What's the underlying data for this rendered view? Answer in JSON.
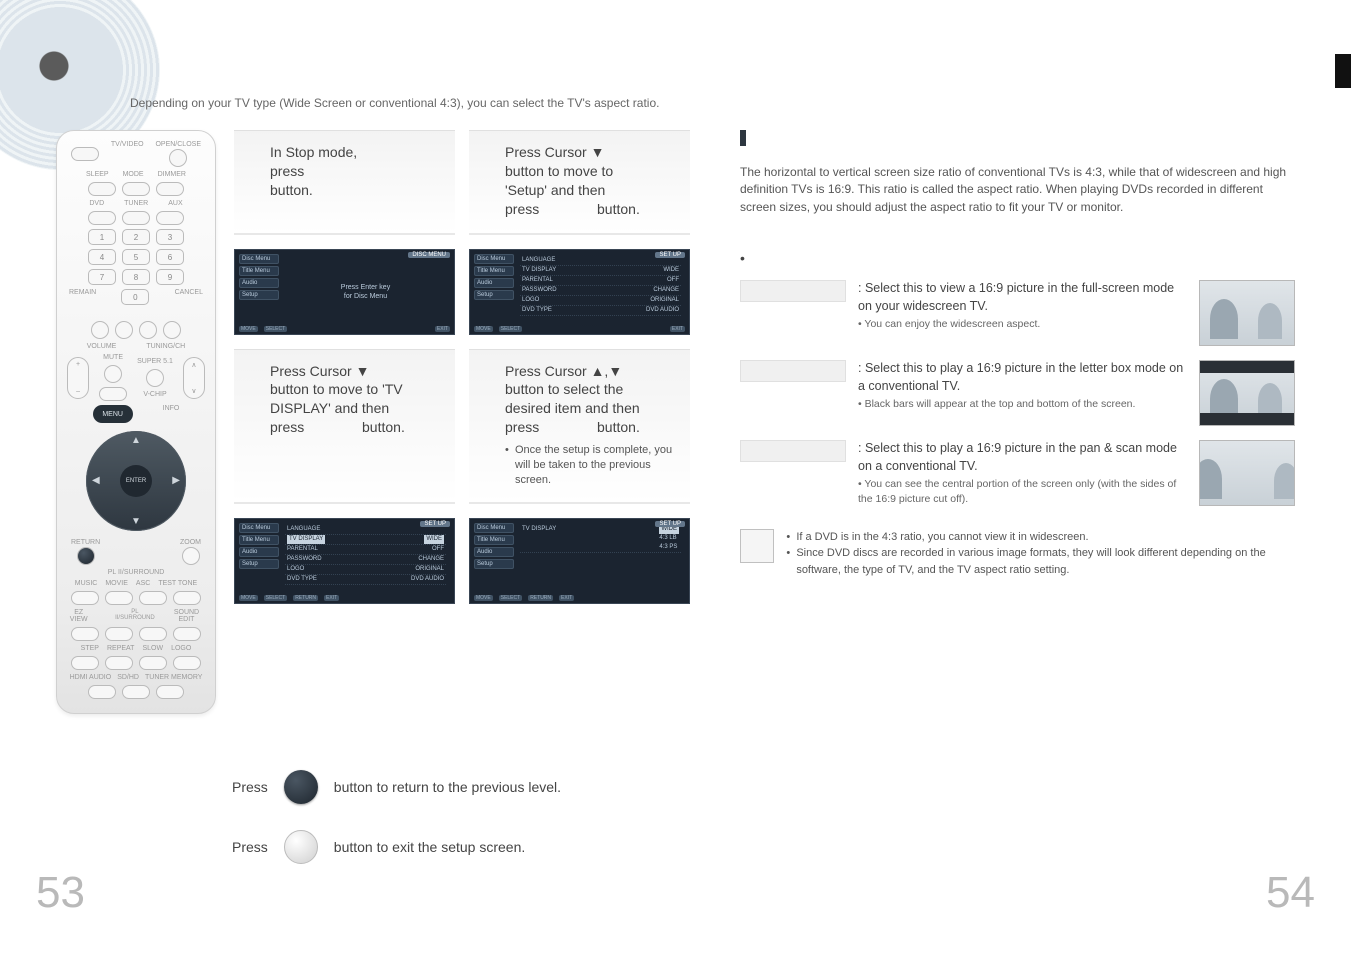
{
  "lead": "Depending on your TV type (Wide Screen  or conventional 4:3), you can select the TV's aspect ratio.",
  "remote": {
    "labels": {
      "openclose": "OPEN/CLOSE",
      "tvvideo": "TV/VIDEO",
      "sleep": "SLEEP",
      "mode": "MODE",
      "dimmer": "DIMMER",
      "dvd": "DVD",
      "tuner": "TUNER",
      "aux": "AUX",
      "remain": "REMAIN",
      "cancel": "CANCEL",
      "volume": "VOLUME",
      "tuning": "TUNING/CH",
      "mute": "MUTE",
      "super": "SUPER 5.1",
      "vchip": "V-CHIP",
      "menu": "MENU",
      "info": "INFO",
      "enter": "ENTER",
      "return": "RETURN",
      "zoom": "ZOOM",
      "plii": "PL II/SURROUND",
      "music": "MUSIC",
      "movie": "MOVIE",
      "asc": "ASC",
      "testtone": "TEST TONE",
      "ezview": "EZ VIEW",
      "soundedit": "SOUND EDIT",
      "step": "STEP",
      "repeat": "REPEAT",
      "slow": "SLOW",
      "logo": "LOGO",
      "hdmiaudio": "HDMI AUDIO",
      "sdhd": "SD/HD",
      "tunermemory": "TUNER MEMORY"
    }
  },
  "steps": {
    "s1": {
      "line1": "In Stop mode,",
      "line2": "press",
      "line3": "button."
    },
    "s2": {
      "line1": "Press Cursor ▼",
      "line2": "button to move to",
      "line3": "'Setup' and then",
      "line4": "press",
      "line5": "button."
    },
    "s3": {
      "line1": "Press Cursor ▼",
      "line2": "button to move to 'TV",
      "line3": "DISPLAY' and then",
      "line4": "press",
      "line5": "button."
    },
    "s4": {
      "line1": "Press Cursor ▲,▼",
      "line2": "button to select the",
      "line3": "desired item and then",
      "line4": "press",
      "line5": "button.",
      "note": "Once the setup is complete, you will be taken to the previous screen."
    }
  },
  "osd": {
    "tabs": [
      "Disc Menu",
      "Title Menu",
      "Audio",
      "Setup"
    ],
    "setup": "SET UP",
    "discmenu": "DISC MENU",
    "centerA": "Press Enter key",
    "centerB": "for Disc Menu",
    "items": [
      {
        "k": "LANGUAGE",
        "v": ""
      },
      {
        "k": "TV DISPLAY",
        "v": "WIDE"
      },
      {
        "k": "PARENTAL",
        "v": "OFF"
      },
      {
        "k": "PASSWORD",
        "v": "CHANGE"
      },
      {
        "k": "LOGO",
        "v": "ORIGINAL"
      },
      {
        "k": "DVD TYPE",
        "v": "DVD AUDIO"
      }
    ],
    "tvopts": [
      "WIDE",
      "4:3 LB",
      "4:3 PS"
    ],
    "foot": [
      "MOVE",
      "SELECT",
      "RETURN",
      "EXIT"
    ]
  },
  "right": {
    "desc": "The horizontal to vertical screen size ratio of conventional TVs is 4:3, while that of widescreen and high definition TVs is 16:9. This ratio is called the aspect ratio. When playing DVDs recorded in different screen sizes, you should adjust the aspect ratio to fit your TV or monitor.",
    "opts": [
      {
        "main": ": Select this to view a 16:9 picture in the full-screen mode on your widescreen TV.",
        "sub": "• You can enjoy the widescreen aspect."
      },
      {
        "main": ": Select this to play a 16:9 picture in the letter box mode on a conventional TV.",
        "sub": "• Black bars will appear at the top and bottom of the screen."
      },
      {
        "main": ": Select this to play a 16:9 picture in the pan & scan mode on a conventional TV.",
        "sub": "• You can see the central portion of the screen only (with the sides of the 16:9 picture cut off)."
      }
    ],
    "notes": [
      "If a DVD is in the 4:3 ratio, you cannot view it in widescreen.",
      "Since DVD discs are recorded in various image formats, they will look different depending on the software, the type of TV, and the TV aspect ratio setting."
    ]
  },
  "footer": {
    "return": {
      "press": "Press",
      "rest": "button to return to the previous level."
    },
    "exit": {
      "press": "Press",
      "rest": "button to exit the setup screen."
    }
  },
  "pages": {
    "left": "53",
    "right": "54"
  }
}
